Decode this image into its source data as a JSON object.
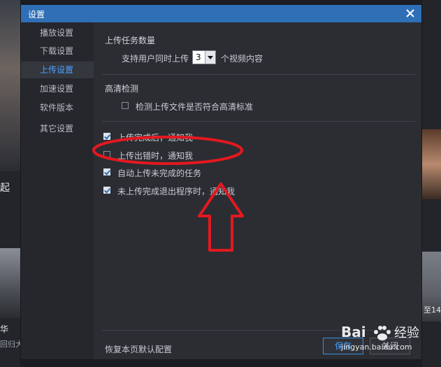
{
  "background": {
    "left_text_1": "起",
    "left_text_2": "华",
    "left_text_3": "回归大",
    "right_text_1": "至14"
  },
  "dialog": {
    "title": "设置",
    "close_icon": "close-icon"
  },
  "sidebar": {
    "items": [
      {
        "label": "播放设置",
        "active": false
      },
      {
        "label": "下载设置",
        "active": false
      },
      {
        "label": "上传设置",
        "active": true
      },
      {
        "label": "加速设置",
        "active": false
      },
      {
        "label": "软件版本",
        "active": false
      },
      {
        "label": "其它设置",
        "active": false
      }
    ]
  },
  "upload_tasks": {
    "section_title": "上传任务数量",
    "prefix": "支持用户同时上传",
    "value": "3",
    "suffix": "个视频内容"
  },
  "hd_check": {
    "section_title": "高清检测",
    "option_label": "检测上传文件是否符合高清标准",
    "checked": false
  },
  "notifications": [
    {
      "label": "上传完成后，通知我",
      "checked": true
    },
    {
      "label": "上传出错时，通知我",
      "checked": false
    },
    {
      "label": "自动上传未完成的任务",
      "checked": true
    },
    {
      "label": "未上传完成退出程序时，通知我",
      "checked": true
    }
  ],
  "footer": {
    "restore_defaults": "恢复本页默认配置",
    "save_label": "保存",
    "close_label": "关闭"
  },
  "annotation": {
    "color": "#e3191f"
  },
  "watermark": {
    "text": "jingyan.baidu.com",
    "logo": "Bai 经验"
  },
  "colors": {
    "accent": "#2f6fb6",
    "active_text": "#4aa3ff"
  }
}
